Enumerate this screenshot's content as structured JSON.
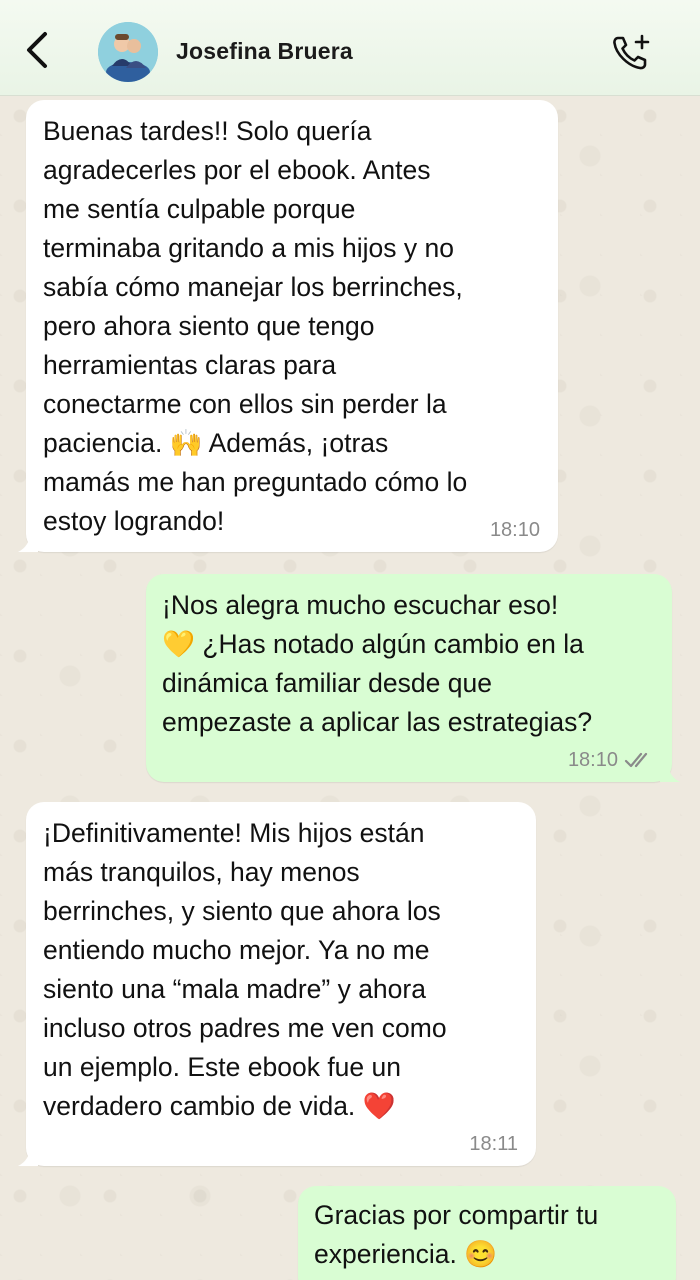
{
  "header": {
    "back_icon": "chevron-left-icon",
    "contact_name": "Josefina Bruera",
    "call_icon": "phone-plus-icon"
  },
  "messages": [
    {
      "direction": "incoming",
      "text": "Buenas tardes!! Solo quería\nagradecerles por el ebook. Antes\nme sentía culpable porque\nterminaba gritando a mis hijos y no\nsabía cómo manejar los berrinches,\npero ahora siento que tengo\nherramientas claras para\nconectarme con ellos sin perder la\npaciencia. 🙌 Además, ¡otras\nmamás me han preguntado cómo lo\nestoy logrando!",
      "time": "18:10"
    },
    {
      "direction": "outgoing",
      "text": "¡Nos alegra mucho escuchar eso!\n💛 ¿Has notado algún cambio en la\ndinámica familiar desde que\nempezaste a aplicar las estrategias?",
      "time": "18:10",
      "status": "read"
    },
    {
      "direction": "incoming",
      "text": "¡Definitivamente! Mis hijos están\nmás tranquilos, hay menos\nberrinches, y siento que ahora los\nentiendo mucho mejor. Ya no me\nsiento una “mala madre” y ahora\nincluso otros padres me ven como\nun ejemplo. Este ebook fue un\nverdadero cambio de vida. ❤️",
      "time": "18:11"
    },
    {
      "direction": "outgoing",
      "text": "Gracias por compartir tu\nexperiencia. 😊",
      "time": ""
    }
  ],
  "colors": {
    "incoming_bubble": "#ffffff",
    "outgoing_bubble": "#d9fdd3",
    "chat_background": "#efeae2",
    "read_ticks": "#8a8a8a"
  }
}
